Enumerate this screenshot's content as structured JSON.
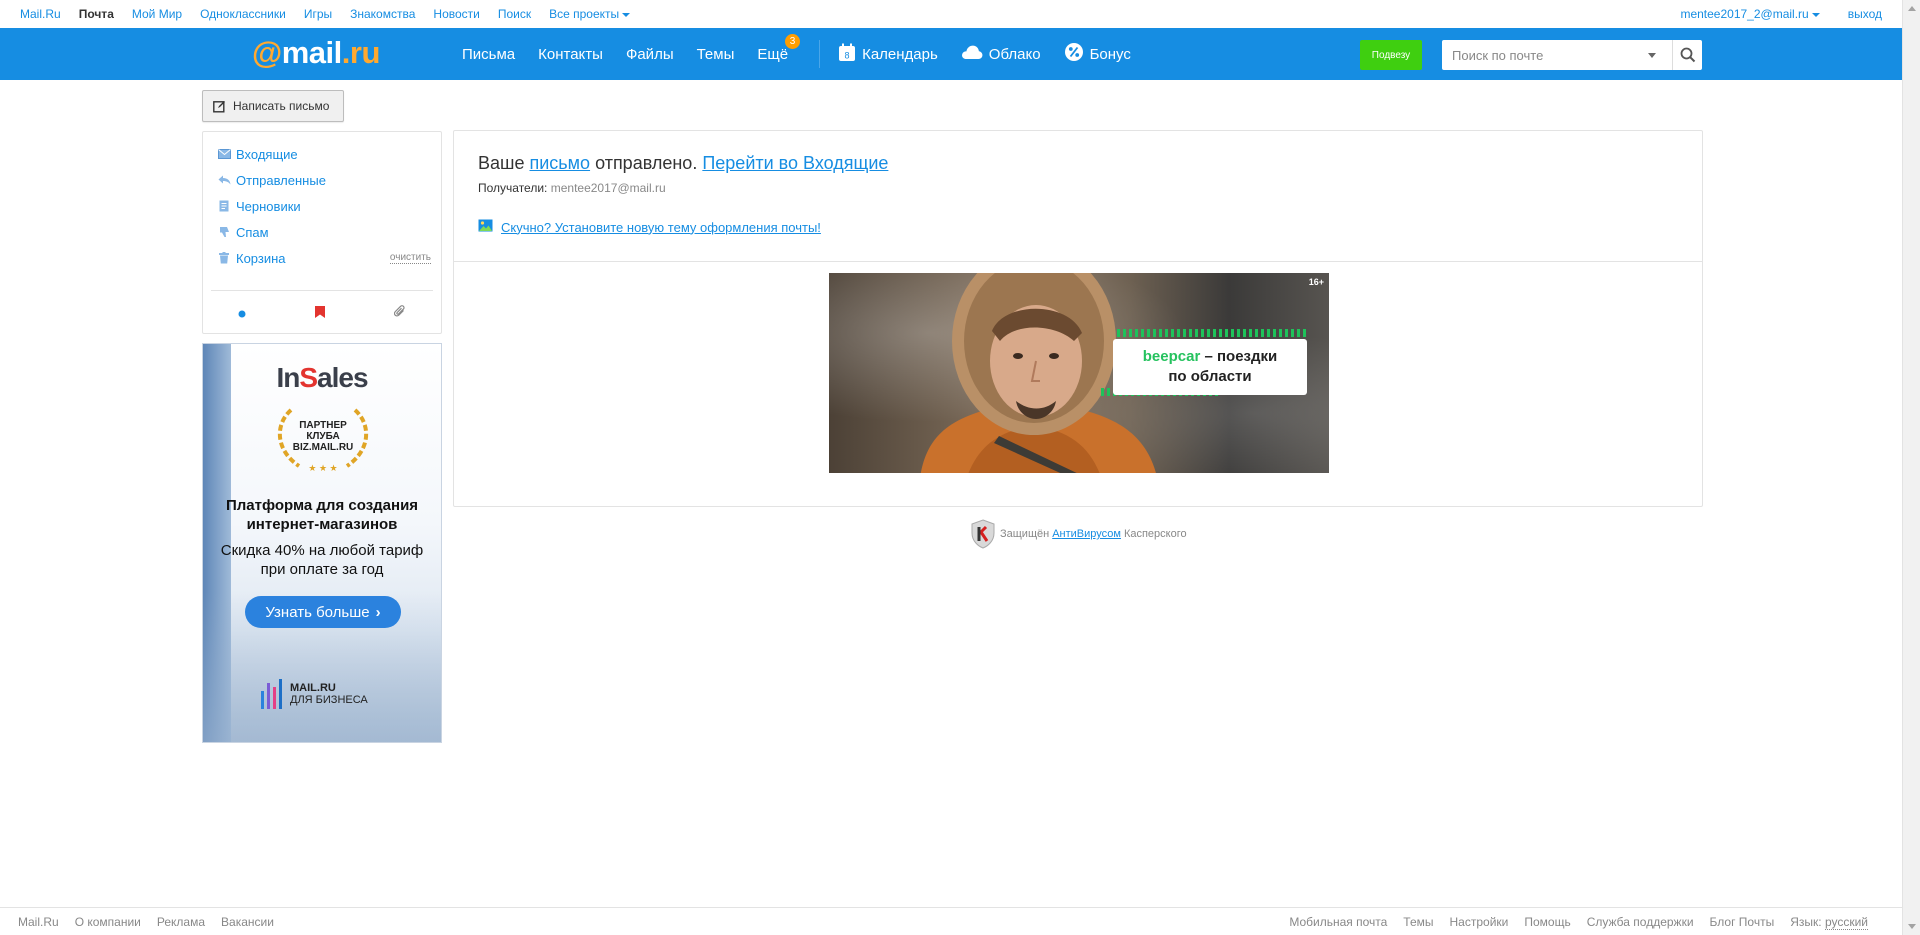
{
  "portal": {
    "links": [
      "Mail.Ru",
      "Почта",
      "Мой Мир",
      "Одноклассники",
      "Игры",
      "Знакомства",
      "Новости",
      "Поиск",
      "Все проекты"
    ],
    "user": "mentee2017_2@mail.ru",
    "logout": "выход"
  },
  "header": {
    "logo_at": "@",
    "logo_mail": "mail",
    "logo_ru": ".ru",
    "nav": [
      "Письма",
      "Контакты",
      "Файлы",
      "Темы",
      "Ещё"
    ],
    "more_badge": "3",
    "services": [
      "Календарь",
      "Облако",
      "Бонус"
    ],
    "calendar_day": "8",
    "green_button": "Подвезу",
    "search_placeholder": "Поиск по почте",
    "accent": "#168de2"
  },
  "compose": {
    "label": "Написать письмо"
  },
  "folders": {
    "items": [
      "Входящие",
      "Отправленные",
      "Черновики",
      "Спам",
      "Корзина"
    ],
    "clear": "очистить"
  },
  "ad_left": {
    "brand_in": "In",
    "brand_s": "S",
    "brand_ales": "ales",
    "badge": [
      "ПАРТНЕР",
      "КЛУБА",
      "BIZ.MAIL.RU"
    ],
    "headline": "Платформа для создания интернет-магазинов",
    "subline": "Скидка 40% на любой тариф при оплате за год",
    "cta": "Узнать больше",
    "footer_brand": "MAIL.RU",
    "footer_sub": "ДЛЯ БИЗНЕСА"
  },
  "message": {
    "prefix": "Ваше",
    "letter_link": "письмо",
    "sent_text": "отправлено.",
    "inbox_link": "Перейти во Входящие",
    "recipients_label": "Получатели:",
    "recipients_value": "mentee2017@mail.ru",
    "theme_link": "Скучно? Установите новую тему оформления почты!"
  },
  "banner": {
    "age": "16+",
    "brand": "beepcar",
    "text1": " – поездки",
    "text2": "по области"
  },
  "kaspersky": {
    "prefix": "Защищён",
    "link": "АнтиВирусом",
    "suffix": "Касперского"
  },
  "footer": {
    "left": [
      "Mail.Ru",
      "О компании",
      "Реклама",
      "Вакансии"
    ],
    "right": [
      "Мобильная почта",
      "Темы",
      "Настройки",
      "Помощь",
      "Служба поддержки",
      "Блог Почты"
    ],
    "lang_label": "Язык:",
    "lang_value": "русский"
  }
}
